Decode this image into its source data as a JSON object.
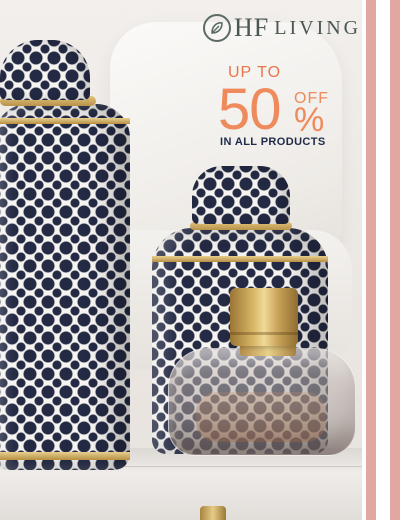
{
  "brand": {
    "logo_icon": "leaf-in-o-icon",
    "logo_hf": "HF",
    "logo_living": "LIVING",
    "colors": {
      "logo": "#4a5753",
      "accent": "#ee8a5b",
      "navy": "#1f2b4a",
      "stripe": "#e3a7a2"
    }
  },
  "promo": {
    "top_line": "UP TO",
    "discount_number": "50",
    "off": "OFF",
    "percent": "%",
    "bottom_line": "IN ALL PRODUCTS"
  }
}
